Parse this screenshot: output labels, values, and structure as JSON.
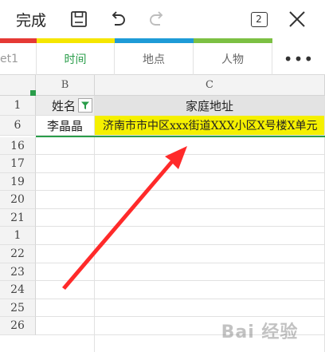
{
  "toolbar": {
    "done_label": "完成",
    "pages_count": "2"
  },
  "tabs": [
    {
      "label": "et1"
    },
    {
      "label": "时间"
    },
    {
      "label": "地点"
    },
    {
      "label": "人物"
    }
  ],
  "more_label": "•••",
  "columns": [
    "B",
    "C"
  ],
  "rows": [
    "1",
    "6",
    "16",
    "17",
    "19",
    "20",
    "21",
    "1",
    "22",
    "23",
    "24",
    "25",
    "26"
  ],
  "header_row": {
    "name": "姓名",
    "address": "家庭地址"
  },
  "data_row": {
    "name": "李晶晶",
    "address": "济南市市中区xxx街道XXX小区X号楼X单元"
  },
  "watermark": "Bai 经验",
  "colors": {
    "accent": "#2a9d4a",
    "highlight": "#f5f000",
    "arrow": "#ff2a2a",
    "strips": [
      "#e53935",
      "#f5e600",
      "#1e9bd7",
      "#7cc043"
    ]
  }
}
